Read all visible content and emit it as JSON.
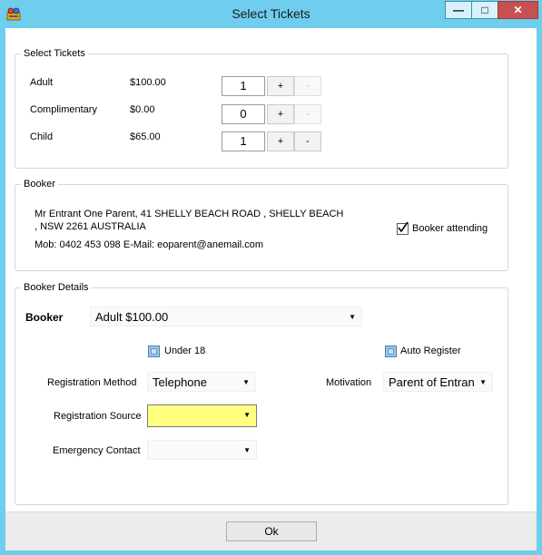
{
  "window": {
    "title": "Select Tickets",
    "min_label": "—",
    "max_label": "□",
    "close_label": "✕"
  },
  "select_tickets": {
    "legend": "Select Tickets",
    "rows": [
      {
        "label": "Adult",
        "price": "$100.00",
        "qty": "1",
        "plus": "+",
        "minus": "-",
        "minus_enabled": false
      },
      {
        "label": "Complimentary",
        "price": "$0.00",
        "qty": "0",
        "plus": "+",
        "minus": "-",
        "minus_enabled": false
      },
      {
        "label": "Child",
        "price": "$65.00",
        "qty": "1",
        "plus": "+",
        "minus": "-",
        "minus_enabled": true
      }
    ]
  },
  "booker": {
    "legend": "Booker",
    "address_line1": "Mr Entrant One Parent,  41 SHELLY BEACH ROAD , SHELLY BEACH",
    "address_line2": ", NSW 2261 AUSTRALIA",
    "contact": "Mob: 0402 453 098 E-Mail: eoparent@anemail.com",
    "attending_label": "Booker attending",
    "attending_checked": true
  },
  "booker_details": {
    "legend": "Booker Details",
    "booker_label": "Booker",
    "booker_value": "Adult $100.00",
    "under18_label": "Under 18",
    "auto_register_label": "Auto Register",
    "reg_method_label": "Registration Method",
    "reg_method_value": "Telephone",
    "motivation_label": "Motivation",
    "motivation_value": "Parent of Entran",
    "reg_source_label": "Registration Source",
    "reg_source_value": "",
    "emergency_label": "Emergency Contact",
    "emergency_value": ""
  },
  "footer": {
    "ok_label": "Ok"
  },
  "colors": {
    "titlebar": "#6fcdee",
    "close_button": "#c75050",
    "highlight_field": "#ffff80"
  }
}
